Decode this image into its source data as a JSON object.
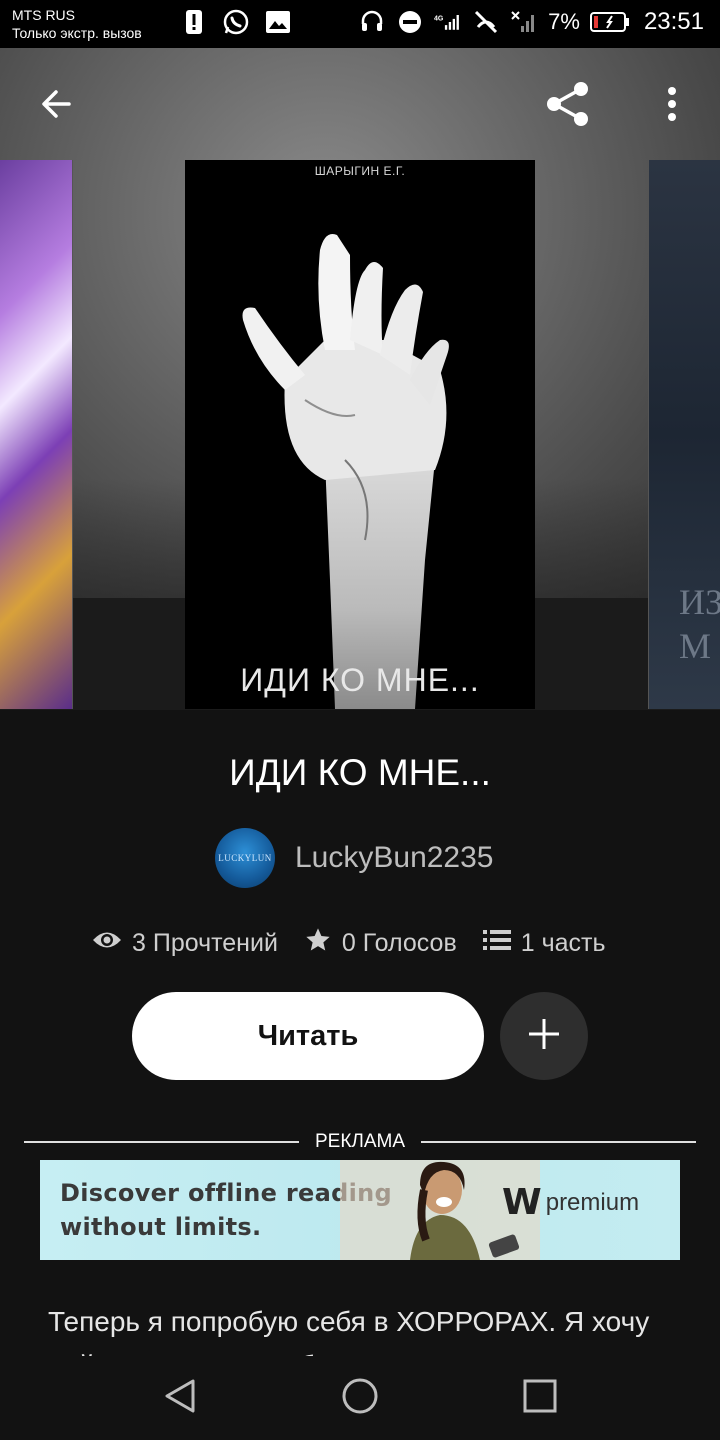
{
  "status_bar": {
    "carrier": "MTS RUS",
    "carrier_status": "Только экстр. вызов",
    "battery": "7%",
    "time": "23:51",
    "network": "4G"
  },
  "app_bar": {
    "back_icon": "arrow-left-icon",
    "share_icon": "share-icon",
    "menu_icon": "more-vert-icon"
  },
  "cover": {
    "author_text": "ШАРЫГИН Е.Г.",
    "title_text": "ИДИ КО МНЕ...",
    "right_cover_text": "ИЗ\nМ"
  },
  "book": {
    "title": "ИДИ КО МНЕ...",
    "author": "LuckyBun2235",
    "avatar_text": "LUCKYLUN"
  },
  "stats": {
    "reads": "3 Прочтений",
    "votes": "0 Голосов",
    "parts": "1 часть"
  },
  "actions": {
    "read_label": "Читать",
    "add_icon": "plus-icon"
  },
  "ad": {
    "label": "РЕКЛАМА",
    "line1": "Discover offline reading",
    "line2": "without limits.",
    "logo_mark": "W",
    "logo_text": "premium"
  },
  "description": {
    "text": "Теперь я попробую себя в ХОРРОРАХ. Я хочу найти то что и мне будет приятно писать, и"
  },
  "colors": {
    "background": "#121212",
    "button": "#ffffff",
    "ad_background": "#c6eef3"
  }
}
